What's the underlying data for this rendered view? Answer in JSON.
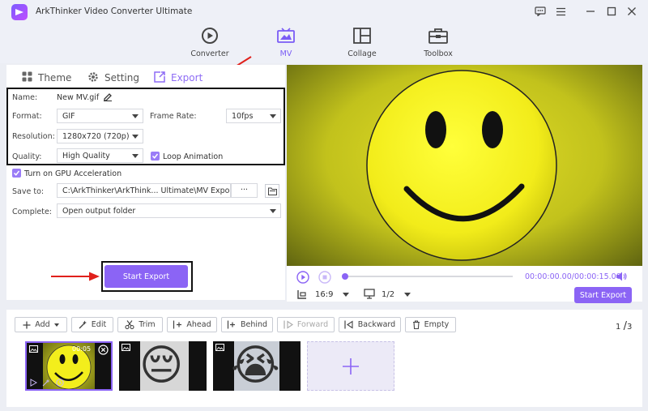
{
  "app": {
    "title": "ArkThinker Video Converter Ultimate"
  },
  "nav": {
    "tabs": [
      {
        "label": "Converter",
        "icon": "converter-icon"
      },
      {
        "label": "MV",
        "icon": "mv-icon",
        "active": true
      },
      {
        "label": "Collage",
        "icon": "collage-icon"
      },
      {
        "label": "Toolbox",
        "icon": "toolbox-icon"
      }
    ]
  },
  "subtabs": {
    "theme": "Theme",
    "setting": "Setting",
    "export": "Export"
  },
  "export_settings": {
    "name_label": "Name:",
    "name_value": "New MV.gif",
    "format_label": "Format:",
    "format_value": "GIF",
    "frame_rate_label": "Frame Rate:",
    "frame_rate_value": "10fps",
    "resolution_label": "Resolution:",
    "resolution_value": "1280x720 (720p)",
    "quality_label": "Quality:",
    "quality_value": "High Quality",
    "loop_label": "Loop Animation",
    "gpu_label": "Turn on GPU Acceleration",
    "save_to_label": "Save to:",
    "save_to_value": "C:\\ArkThinker\\ArkThink... Ultimate\\MV Exported",
    "browse_label": "···",
    "complete_label": "Complete:",
    "complete_value": "Open output folder",
    "start_export": "Start Export"
  },
  "player": {
    "time": "00:00:00.00/00:00:15.00",
    "aspect": "16:9",
    "zoom": "1/2",
    "export": "Start Export"
  },
  "toolbar": {
    "add": "Add",
    "edit": "Edit",
    "trim": "Trim",
    "ahead": "Ahead",
    "behind": "Behind",
    "forward": "Forward",
    "backward": "Backward",
    "empty": "Empty",
    "page_current": "1",
    "page_sep": "/",
    "page_total": "3"
  },
  "clips": [
    {
      "duration": "00:05",
      "emoji": "😃"
    },
    {
      "emoji": "😔"
    },
    {
      "emoji": "😭"
    }
  ],
  "colors": {
    "accent": "#8b64f5",
    "highlight_box": "#111111",
    "annotation": "#e0201b"
  }
}
